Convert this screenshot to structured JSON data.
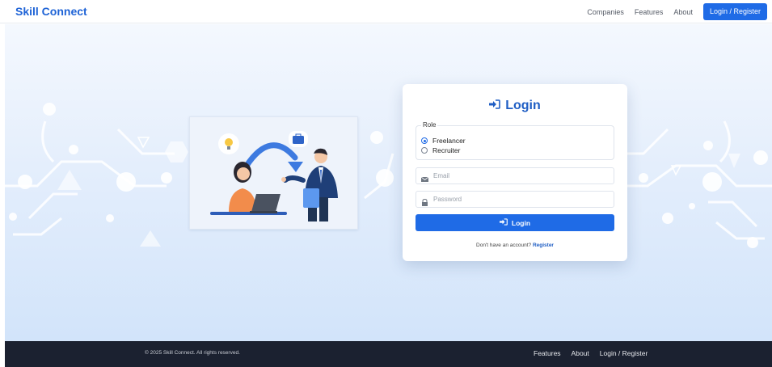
{
  "navbar": {
    "brand": "Skill Connect",
    "links": [
      "Companies",
      "Features",
      "About"
    ],
    "cta": "Login / Register"
  },
  "login": {
    "title": "Login",
    "role_legend": "Role",
    "roles": [
      {
        "label": "Freelancer",
        "selected": true
      },
      {
        "label": "Recruiter",
        "selected": false
      }
    ],
    "email_placeholder": "Email",
    "password_placeholder": "Password",
    "submit": "Login",
    "signup_prompt": "Don't have an account?",
    "signup_link": "Register"
  },
  "footer": {
    "copyright": "© 2025 Skill Connect. All rights reserved.",
    "links": [
      "Features",
      "About",
      "Login / Register"
    ]
  },
  "colors": {
    "primary": "#1f6be6",
    "brand": "#1e63d6",
    "footer_bg": "#1b2130"
  },
  "icons": {
    "title_icon": "sign-in-icon",
    "email_icon": "envelope-icon",
    "password_icon": "lock-icon"
  }
}
